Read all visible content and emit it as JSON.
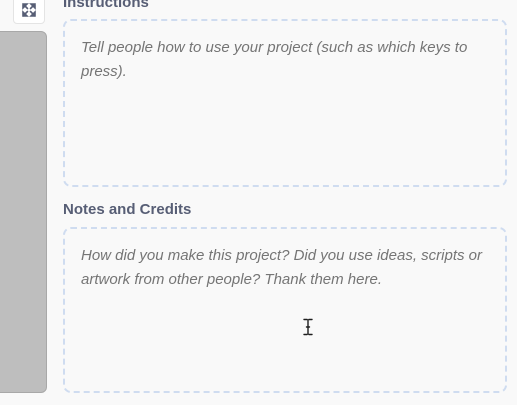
{
  "icons": {
    "fullscreen": "fullscreen-expand-icon",
    "cursor": "text-cursor-icon"
  },
  "instructions": {
    "label": "Instructions",
    "placeholder": "Tell people how to use your project (such as which keys to press).",
    "value": ""
  },
  "notes": {
    "label": "Notes and Credits",
    "placeholder": "How did you make this project? Did you use ideas, scripts or artwork from other people? Thank them here.",
    "value": ""
  },
  "colors": {
    "label_text": "#575e75",
    "placeholder_text": "#8b8b8b",
    "dashed_border": "#cfdcf0",
    "background": "#f9f9f9",
    "player_panel": "#bebebe"
  }
}
